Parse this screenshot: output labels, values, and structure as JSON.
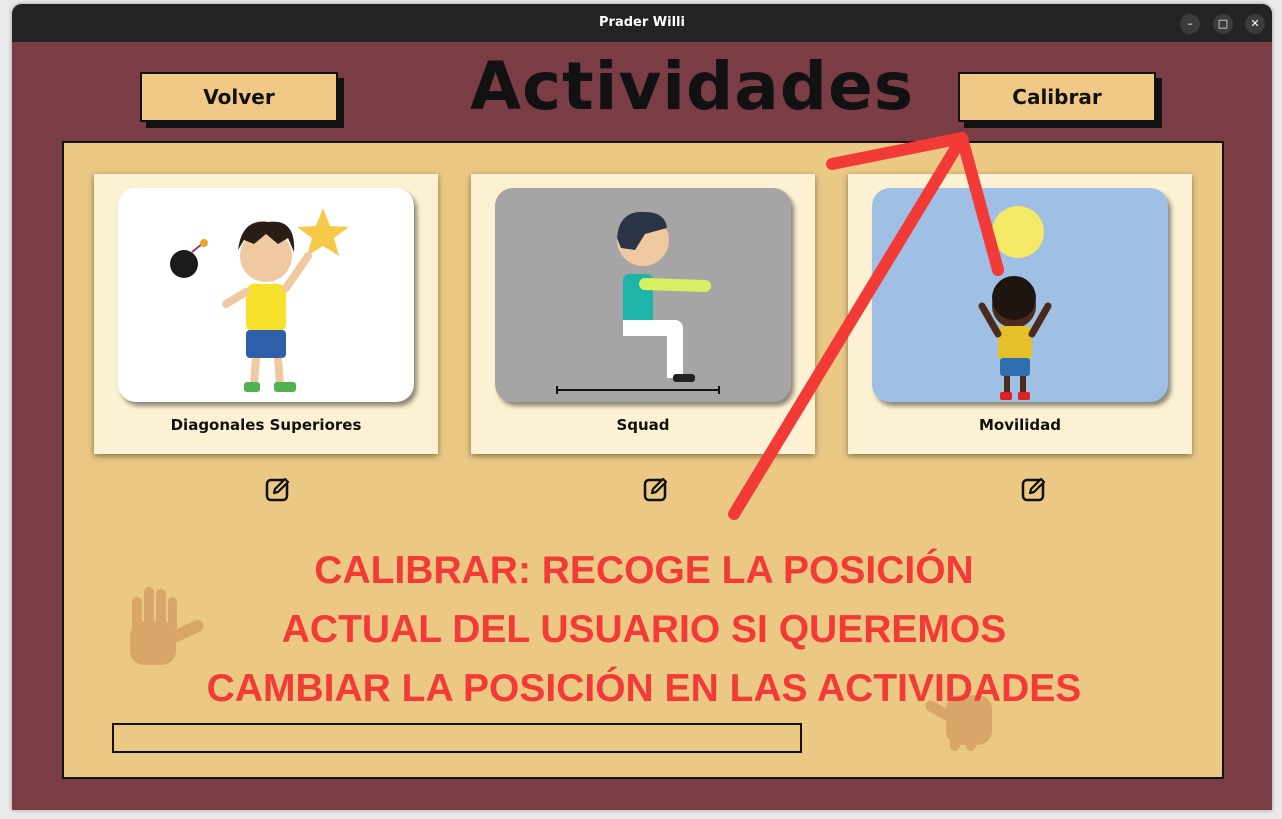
{
  "window": {
    "title": "Prader Willi",
    "controls": {
      "minimize": "–",
      "maximize": "□",
      "close": "✕"
    }
  },
  "header": {
    "title": "Actividades",
    "back_label": "Volver",
    "calibrate_label": "Calibrar"
  },
  "activities": [
    {
      "label": "Diagonales Superiores",
      "icon": "edit-icon"
    },
    {
      "label": "Squad",
      "icon": "edit-icon"
    },
    {
      "label": "Movilidad",
      "icon": "edit-icon"
    }
  ],
  "annotation": {
    "lines": [
      "CALIBRAR: RECOGE LA POSICIÓN",
      "ACTUAL DEL USUARIO SI QUEREMOS",
      "CAMBIAR LA POSICIÓN EN LAS ACTIVIDADES"
    ],
    "color": "#f23a36"
  },
  "progress": {
    "value": 0
  },
  "colors": {
    "background": "#7a3d45",
    "panel": "#ebc985",
    "button": "#f0c987",
    "card": "#fcf2d3",
    "titlebar": "#232323"
  }
}
